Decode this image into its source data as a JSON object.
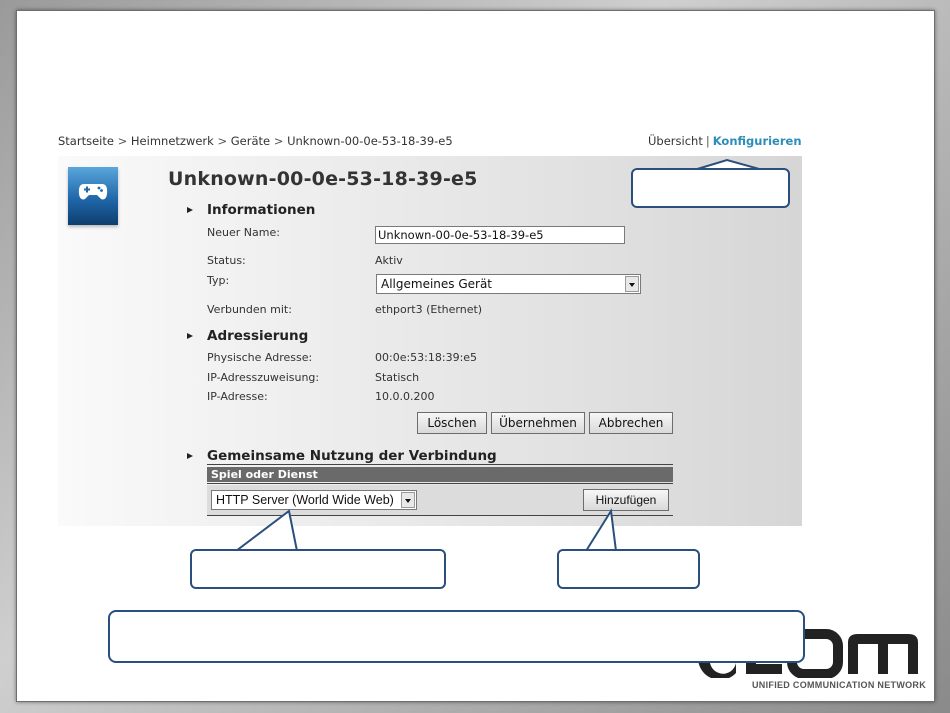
{
  "breadcrumb": {
    "items": [
      "Startseite",
      "Heimnetzwerk",
      "Geräte",
      "Unknown-00-0e-53-18-39-e5"
    ],
    "separator": ">"
  },
  "topnav": {
    "overview": "Übersicht",
    "separator": "|",
    "configure": "Konfigurieren"
  },
  "device": {
    "title": "Unknown-00-0e-53-18-39-e5",
    "icon": "gamepad-icon"
  },
  "informationen": {
    "heading": "Informationen",
    "new_name_label": "Neuer Name:",
    "new_name_value": "Unknown-00-0e-53-18-39-e5",
    "status_label": "Status:",
    "status_value": "Aktiv",
    "type_label": "Typ:",
    "type_value": "Allgemeines Gerät",
    "connected_label": "Verbunden mit:",
    "connected_value": "ethport3 (Ethernet)"
  },
  "adressierung": {
    "heading": "Adressierung",
    "mac_label": "Physische Adresse:",
    "mac_value": "00:0e:53:18:39:e5",
    "ipassign_label": "IP-Adresszuweisung:",
    "ipassign_value": "Statisch",
    "ip_label": "IP-Adresse:",
    "ip_value": "10.0.0.200"
  },
  "buttons": {
    "delete": "Löschen",
    "apply": "Übernehmen",
    "cancel": "Abbrechen"
  },
  "sharing": {
    "heading": "Gemeinsame Nutzung der Verbindung",
    "column": "Spiel oder Dienst",
    "service_value": "HTTP Server (World Wide Web)",
    "add_button": "Hinzufügen"
  },
  "branding": {
    "logo_text": "UNIFIED COMMUNICATION NETWORK",
    "logo_color": "#222222"
  },
  "colors": {
    "accent": "#2c8db8",
    "callout_border": "#2a4f7c"
  }
}
